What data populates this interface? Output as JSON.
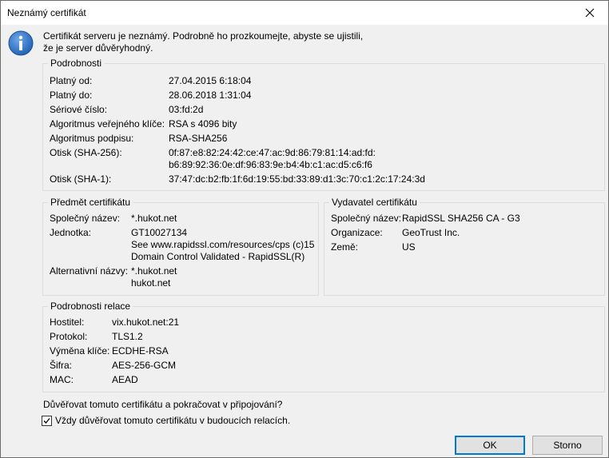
{
  "window": {
    "title": "Neznámý certifikát"
  },
  "message": {
    "line1": "Certifikát serveru je neznámý. Podrobně ho prozkoumejte, abyste se ujistili,",
    "line2": "že je server důvěryhodný."
  },
  "details": {
    "title": "Podrobnosti",
    "rows": [
      {
        "label": "Platný od:",
        "value": "27.04.2015 6:18:04"
      },
      {
        "label": "Platný do:",
        "value": "28.06.2018 1:31:04"
      },
      {
        "label": "Sériové číslo:",
        "value": "03:fd:2d"
      },
      {
        "label": "Algoritmus veřejného klíče:",
        "value": "RSA s 4096 bity"
      },
      {
        "label": "Algoritmus podpisu:",
        "value": "RSA-SHA256"
      },
      {
        "label": "Otisk (SHA-256):",
        "value": "0f:87:e8:82:24:42:ce:47:ac:9d:86:79:81:14:ad:fd:",
        "value2": "b6:89:92:36:0e:df:96:83:9e:b4:4b:c1:ac:d5:c6:f6"
      },
      {
        "label": "Otisk (SHA-1):",
        "value": "37:47:dc:b2:fb:1f:6d:19:55:bd:33:89:d1:3c:70:c1:2c:17:24:3d"
      }
    ]
  },
  "subject": {
    "title": "Předmět certifikátu",
    "common_name_label": "Společný název:",
    "common_name": "*.hukot.net",
    "unit_label": "Jednotka:",
    "unit_lines": [
      "GT10027134",
      "See www.rapidssl.com/resources/cps (c)15",
      "Domain Control Validated - RapidSSL(R)"
    ],
    "alt_label": "Alternativní názvy:",
    "alt_lines": [
      "*.hukot.net",
      "hukot.net"
    ]
  },
  "issuer": {
    "title": "Vydavatel certifikátu",
    "rows": [
      {
        "label": "Společný název:",
        "value": "RapidSSL SHA256 CA - G3"
      },
      {
        "label": "Organizace:",
        "value": "GeoTrust Inc."
      },
      {
        "label": "Země:",
        "value": "US"
      }
    ]
  },
  "session": {
    "title": "Podrobnosti relace",
    "rows": [
      {
        "label": "Hostitel:",
        "value": "vix.hukot.net:21"
      },
      {
        "label": "Protokol:",
        "value": "TLS1.2"
      },
      {
        "label": "Výměna klíče:",
        "value": "ECDHE-RSA"
      },
      {
        "label": "Šifra:",
        "value": "AES-256-GCM"
      },
      {
        "label": "MAC:",
        "value": "AEAD"
      }
    ]
  },
  "question": "Důvěřovat tomuto certifikátu a pokračovat v připojování?",
  "checkbox": {
    "label": "Vždy důvěřovat tomuto certifikátu v budoucích relacích.",
    "checked": true
  },
  "buttons": {
    "ok": "OK",
    "cancel": "Storno"
  },
  "colors": {
    "info_icon": "#1e5fb3",
    "default_button_border": "#0078d7"
  }
}
